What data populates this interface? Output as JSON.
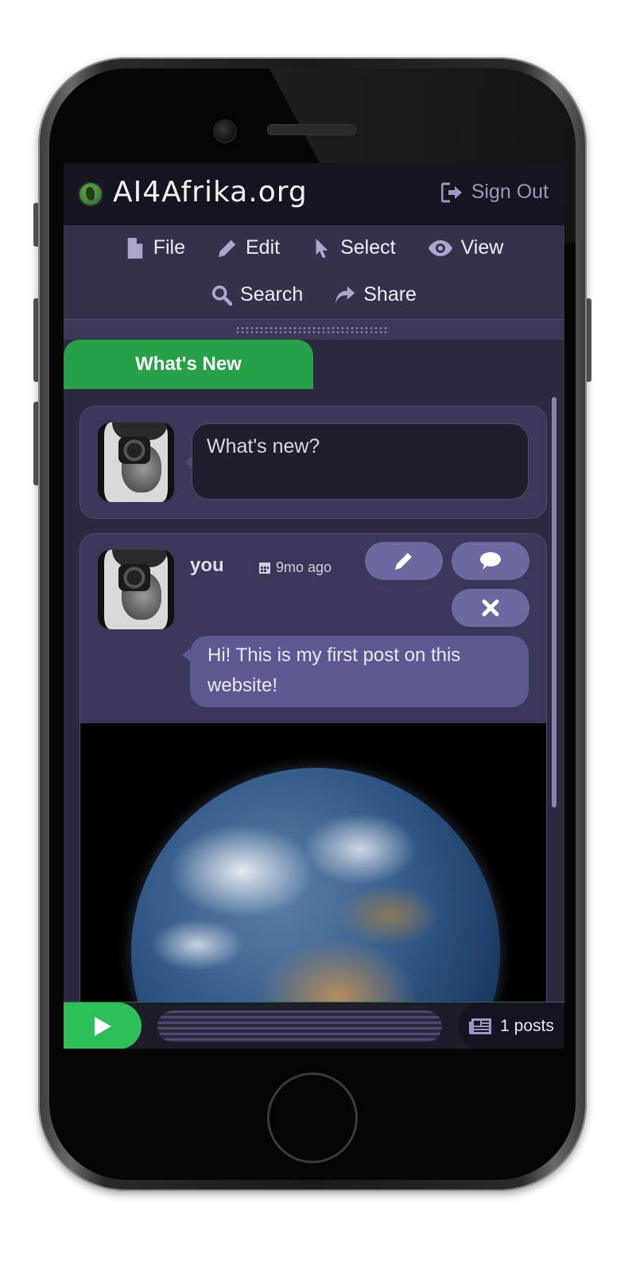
{
  "app": {
    "brand": "AI4Afrika.org",
    "signout_label": "Sign Out"
  },
  "menu": {
    "row1": [
      {
        "label": "File",
        "icon": "file-icon"
      },
      {
        "label": "Edit",
        "icon": "pencil-icon"
      },
      {
        "label": "Select",
        "icon": "cursor-icon"
      },
      {
        "label": "View",
        "icon": "eye-icon"
      }
    ],
    "row2": [
      {
        "label": "Search",
        "icon": "search-icon"
      },
      {
        "label": "Share",
        "icon": "share-icon"
      }
    ]
  },
  "tabs": [
    {
      "label": "What's New",
      "active": true
    }
  ],
  "composer": {
    "placeholder": "What's new?"
  },
  "post": {
    "user": "you",
    "time": "9mo ago",
    "text": "Hi!   This is my first post on this website!",
    "actions": [
      "edit",
      "comment",
      "delete"
    ]
  },
  "footer": {
    "posts_count": "1 posts",
    "progress": 0
  },
  "colors": {
    "accent_green": "#27a048",
    "play_green": "#2fbf5a",
    "panel": "#3a3858",
    "button": "#6c69a0"
  }
}
